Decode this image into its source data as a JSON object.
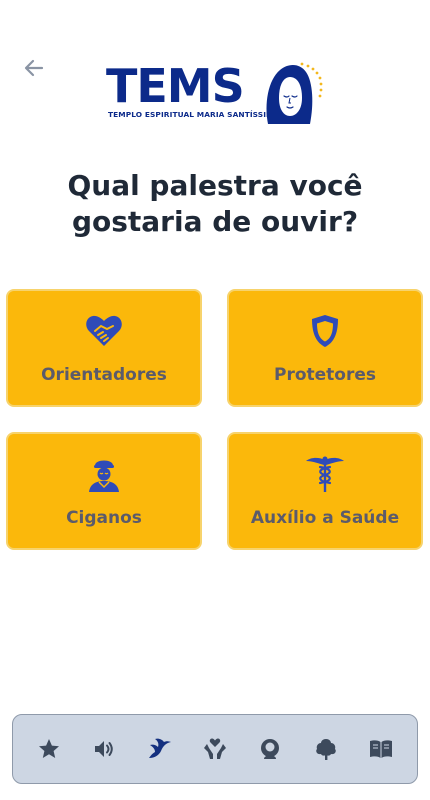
{
  "header": {
    "back_icon": "arrow-left-icon",
    "logo": {
      "text": "TEMS",
      "subtitle": "TEMPLO ESPIRITUAL MARIA SANTÍSSIMA"
    }
  },
  "title": "Qual palestra você gostaria de ouvir?",
  "cards": [
    {
      "label": "Orientadores",
      "icon": "handshake-heart-icon"
    },
    {
      "label": "Protetores",
      "icon": "shield-icon"
    },
    {
      "label": "Ciganos",
      "icon": "gypsy-person-icon"
    },
    {
      "label": "Auxílio a Saúde",
      "icon": "caduceus-icon"
    }
  ],
  "bottom_nav": [
    {
      "icon": "star-icon",
      "active": false
    },
    {
      "icon": "volume-icon",
      "active": false
    },
    {
      "icon": "dove-icon",
      "active": true
    },
    {
      "icon": "hand-heart-icon",
      "active": false
    },
    {
      "icon": "head-profile-icon",
      "active": false
    },
    {
      "icon": "tree-icon",
      "active": false
    },
    {
      "icon": "book-icon",
      "active": false
    }
  ],
  "colors": {
    "card_background": "#fbb80b",
    "card_border": "#f7d36c",
    "icon_blue": "#2f4bb8",
    "label_gray": "#5b5b6b",
    "logo_navy": "#0c2a8a",
    "nav_background": "#cdd6e3",
    "nav_icon": "#3d4a5c",
    "nav_active": "#14307f"
  }
}
